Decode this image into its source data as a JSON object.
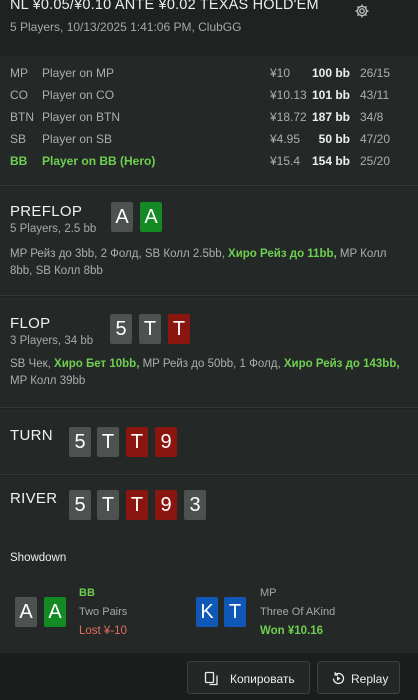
{
  "header": {
    "title": "NL ¥0.05/¥0.10 ANTE ¥0.02 TEXAS HOLD'EM",
    "subtitle": "5 Players, 10/13/2025 1:41:06 PM, ClubGG",
    "settings_icon": "gear-icon"
  },
  "players": [
    {
      "pos": "MP",
      "name": "Player on MP",
      "amount": "¥10",
      "bb": "100 bb",
      "ratio": "26/15"
    },
    {
      "pos": "CO",
      "name": "Player on CO",
      "amount": "¥10.13",
      "bb": "101 bb",
      "ratio": "43/11"
    },
    {
      "pos": "BTN",
      "name": "Player on BTN",
      "amount": "¥18.72",
      "bb": "187 bb",
      "ratio": "34/8"
    },
    {
      "pos": "SB",
      "name": "Player on SB",
      "amount": "¥4.95",
      "bb": "50 bb",
      "ratio": "47/20"
    },
    {
      "pos": "BB",
      "name": "Player on BB (Hero)",
      "amount": "¥15.4",
      "bb": "154 bb",
      "ratio": "25/20"
    }
  ],
  "streets": {
    "preflop": {
      "title": "PREFLOP",
      "sub": "5 Players, 2.5 bb",
      "cards": [
        "A",
        "A"
      ],
      "actions": [
        {
          "text": "MP Рейз до 3bb, 2 Фолд, SB Колл 2.5bb, ",
          "hero": false
        },
        {
          "text": "Хиро Рейз до 11bb,",
          "hero": true
        },
        {
          "text": " MP Колл 8bb, SB Колл 8bb",
          "hero": false
        }
      ]
    },
    "flop": {
      "title": "FLOP",
      "sub": "3 Players, 34 bb",
      "cards": [
        "5",
        "T",
        "T"
      ],
      "actions": [
        {
          "text": "SB Чек, ",
          "hero": false
        },
        {
          "text": "Хиро Бет 10bb,",
          "hero": true
        },
        {
          "text": " MP Рейз до 50bb, 1 Фолд, ",
          "hero": false
        },
        {
          "text": "Хиро Рейз до 143bb,",
          "hero": true
        },
        {
          "text": " MP Колл 39bb",
          "hero": false
        }
      ]
    },
    "turn": {
      "title": "TURN",
      "cards": [
        "5",
        "T",
        "T",
        "9"
      ]
    },
    "river": {
      "title": "RIVER",
      "cards": [
        "5",
        "T",
        "T",
        "9",
        "3"
      ]
    }
  },
  "showdown": {
    "title": "Showdown",
    "players": [
      {
        "pos": "BB",
        "cards": [
          "A",
          "A"
        ],
        "hand": "Two Pairs",
        "result": "Lost ¥-10"
      },
      {
        "pos": "MP",
        "cards": [
          "K",
          "T"
        ],
        "hand": "Three Of AKind",
        "result": "Won ¥10.16"
      }
    ]
  },
  "footer": {
    "copy_label": "Копировать",
    "replay_label": "Replay",
    "copy_icon": "copy-icon",
    "replay_icon": "replay-icon"
  },
  "colors": {
    "background": "#1e2220",
    "panel": "#242927",
    "hero_green": "#6fcf50",
    "loss_red": "#e46b5f",
    "card_grey": "#4d514f",
    "card_green": "#138a24",
    "card_red": "#8b1610",
    "card_blue": "#1058b8"
  }
}
